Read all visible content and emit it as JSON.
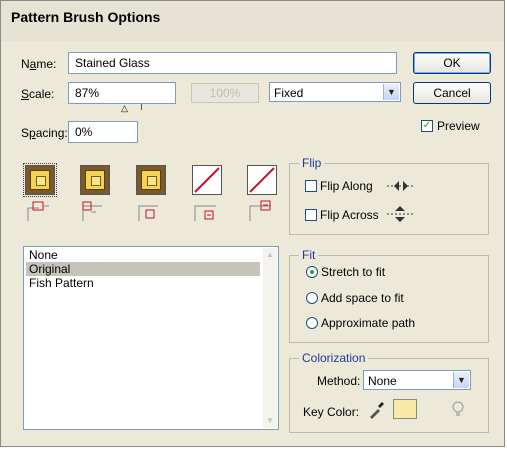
{
  "dialog": {
    "title": "Pattern Brush Options"
  },
  "name_field": {
    "label": "Name:",
    "value": "Stained Glass"
  },
  "scale": {
    "label": "Scale:",
    "value": "87%",
    "disabled_value": "100%",
    "mode": "Fixed"
  },
  "spacing": {
    "label": "Spacing:",
    "value": "0%"
  },
  "buttons": {
    "ok": "OK",
    "cancel": "Cancel"
  },
  "preview": {
    "label": "Preview",
    "checked": true
  },
  "tiles": [
    {
      "kind": "side-tile",
      "icon": "side-tile-icon"
    },
    {
      "kind": "outer-corner-tile",
      "icon": "outer-corner-tile-icon"
    },
    {
      "kind": "inner-corner-tile",
      "icon": "inner-corner-tile-icon"
    },
    {
      "kind": "start-tile",
      "icon": "start-tile-icon"
    },
    {
      "kind": "end-tile",
      "icon": "end-tile-icon"
    }
  ],
  "pattern_list": {
    "items": [
      "None",
      "Original",
      "Fish Pattern"
    ],
    "selected_index": 1
  },
  "flip": {
    "title": "Flip",
    "along": {
      "label": "Flip Along",
      "checked": false
    },
    "across": {
      "label": "Flip Across",
      "checked": false
    }
  },
  "fit": {
    "title": "Fit",
    "options": [
      "Stretch to fit",
      "Add space to fit",
      "Approximate path"
    ],
    "selected_index": 0
  },
  "colorization": {
    "title": "Colorization",
    "method_label": "Method:",
    "method_value": "None",
    "key_color_label": "Key Color:",
    "key_color": "#f8e9a8"
  }
}
